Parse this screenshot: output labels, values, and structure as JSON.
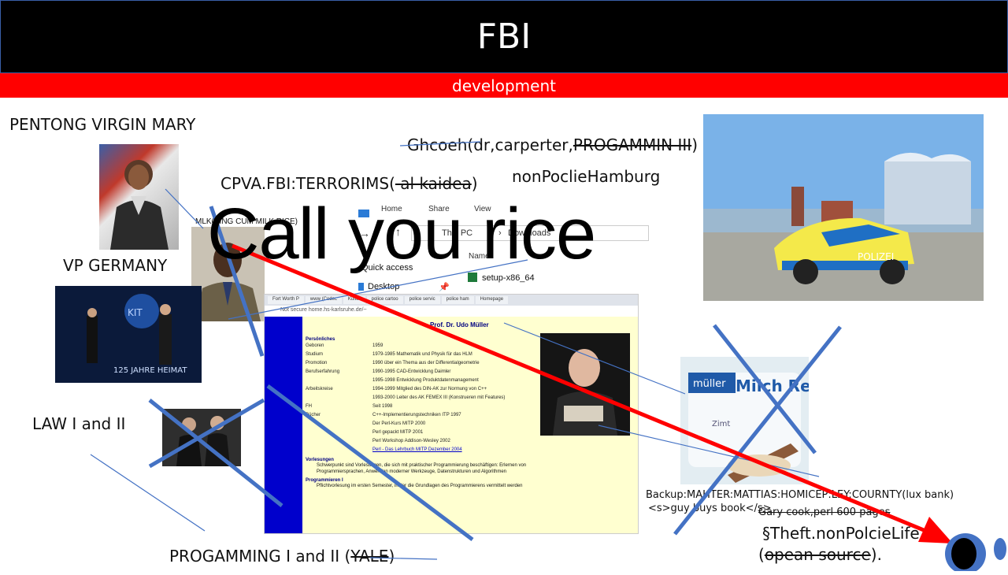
{
  "header": {
    "title": "FBI",
    "subtitle": "development"
  },
  "labels": {
    "pentong": "PENTONG VIRGIN MARY",
    "vp_germany": "VP GERMANY",
    "law": "LAW I and II",
    "programming": "PROGAMMING I and II (",
    "programming_strike": "YALE",
    "programming_end": ")",
    "cpva": "CPVA.FBI:TERRORIMS(",
    "cpva_strike": " al kaidea",
    "cpva_end": ")",
    "ghcoeh": "Ghcoeh(dr,carperter,",
    "ghcoeh_strike": "PROGAMMIN III",
    "ghcoeh_end": ")",
    "nonpolice_hamburg": "nonPoclieHamburg",
    "mlk": "MLK(KING CUM MILK RICE)",
    "call_you_rice": "Call you rice",
    "backup": "Backup:MAHTER:MATTIAS:HOMICEP:LEY:COURNTY(lux bank)",
    "guy_buys": "<s>guy buys book</s>",
    "gary": "Gary cook,perl  600  pages",
    "theft": "§Theft.nonPolcieLife",
    "opean_start": "(",
    "opean_strike": "opean source",
    "opean_end": ")."
  },
  "explorer": {
    "menu": [
      "Home",
      "Share",
      "View"
    ],
    "path": [
      "This PC",
      "Downloads"
    ],
    "name_header": "Name",
    "quick_access": "Quick access",
    "desktop": "Desktop",
    "file": "setup-x86_64"
  },
  "browser": {
    "tabs": [
      "Fort Worth P",
      "www (Codec",
      "Kultur",
      "police cartoo",
      "police servic",
      "police ham",
      "Homepage"
    ],
    "url_secure": "Not secure",
    "url": "home.hs-karlsruhe.de/~",
    "profile_name": "Prof. Dr. Udo Müller",
    "section_personal": "Persönliches",
    "rows": [
      {
        "k": "Geboren",
        "v": "1959"
      },
      {
        "k": "Studium",
        "v": "1979-1985 Mathematik und Physik für das HLM"
      },
      {
        "k": "Promotion",
        "v": "1990 über ein Thema aus der Differentialgeometrie"
      },
      {
        "k": "Berufserfahrung",
        "v": "1990-1995 CAD-Entwicklung Daimler"
      },
      {
        "k": "",
        "v": "1995-1998 Entwicklung Produktdatenmanagement"
      },
      {
        "k": "Arbeitskreise",
        "v": "1994-1999 Mitglied des DIN-AK zur Normung von C++"
      },
      {
        "k": "",
        "v": "1993-2000 Leiter des AK FEMEX III (Konstrueren mit Features)"
      },
      {
        "k": "FH",
        "v": "Seit 1998"
      },
      {
        "k": "Bücher",
        "v": "C++-Implementierungstechniken  ITP 1997"
      },
      {
        "k": "",
        "v": "Der Perl-Kurs  MITP 2000"
      },
      {
        "k": "",
        "v": "Perl gepackt  MITP 2001"
      },
      {
        "k": "",
        "v": "Perl Workshop  Addison-Wesley 2002"
      },
      {
        "k": "",
        "v": "Perl - Das Lehrbuch  MITP Dezember 2004"
      }
    ],
    "section_lectures": "Vorlesungen",
    "lectures_text": "Schwerpunkt sind Vorlesungen, die sich mit praktischer Programmierung beschäftigen: Erlernen von Programmiersprachen, Anwenden moderner Werkzeuge, Datenstrukturen und Algorithmen",
    "section_prog": "Programmieren I",
    "prog_text": "Pflichtvorlesung im ersten Semester, in der die Grundlagen des Programmierens vermittelt werden"
  },
  "photos": {
    "event_banner": "125 JAHRE HEIMAT",
    "milchreis_brand": "müller",
    "milchreis_name": "Milch Reis",
    "milchreis_sub": "Zimt",
    "police_text": "POLIZEI"
  },
  "colors": {
    "header_bg": "#000000",
    "subbar_bg": "#ff0000",
    "arrow_red": "#ff0000",
    "line_blue": "#4472c4",
    "browser_bg": "#ffffd0",
    "sidebar_blue": "#0000cc"
  }
}
